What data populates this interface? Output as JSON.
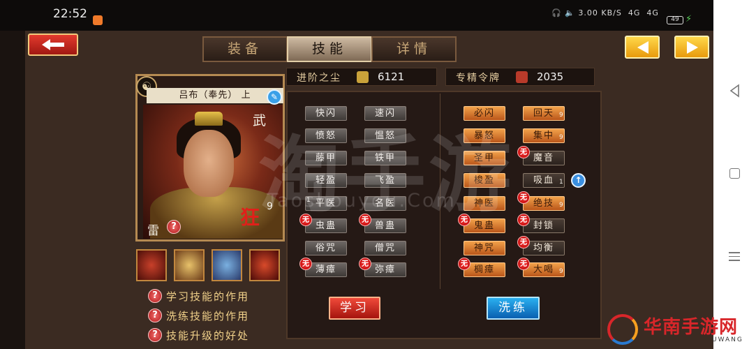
{
  "status_bar": {
    "time": "22:52",
    "network_speed": "3.00 KB/S",
    "signal_1": "4G",
    "signal_2": "4G",
    "battery": "49"
  },
  "tabs": [
    {
      "label": "装备",
      "active": false
    },
    {
      "label": "技能",
      "active": true
    },
    {
      "label": "详情",
      "active": false
    }
  ],
  "resources": {
    "dust_label": "进阶之尘",
    "dust_value": "6121",
    "token_label": "专精令牌",
    "token_value": "2035"
  },
  "hero": {
    "name": "吕布（奉先）",
    "rank": "上",
    "type": "武",
    "trait": "狂",
    "trait_level": "9",
    "element": "雷"
  },
  "skills_left": [
    {
      "name": "快闪",
      "style": "gray"
    },
    {
      "name": "速闪",
      "style": "gray"
    },
    {
      "name": "愤怒",
      "style": "gray"
    },
    {
      "name": "愠怒",
      "style": "gray"
    },
    {
      "name": "藤甲",
      "style": "gray"
    },
    {
      "name": "铁甲",
      "style": "gray"
    },
    {
      "name": "轻盈",
      "style": "gray"
    },
    {
      "name": "飞盈",
      "style": "gray"
    },
    {
      "name": "平医",
      "style": "gray",
      "level": "1"
    },
    {
      "name": "名医",
      "style": "gray"
    },
    {
      "name": "虫蛊",
      "style": "gray",
      "locked": true
    },
    {
      "name": "兽蛊",
      "style": "gray",
      "locked": true
    },
    {
      "name": "俗咒",
      "style": "gray"
    },
    {
      "name": "僧咒",
      "style": "gray"
    },
    {
      "name": "薄瘴",
      "style": "gray",
      "locked": true
    },
    {
      "name": "弥瘴",
      "style": "gray",
      "locked": true
    }
  ],
  "skills_right": [
    {
      "name": "必闪",
      "style": "orange"
    },
    {
      "name": "回天",
      "style": "orange",
      "level": "9"
    },
    {
      "name": "暴怒",
      "style": "orange"
    },
    {
      "name": "集中",
      "style": "orange",
      "level": "9"
    },
    {
      "name": "圣甲",
      "style": "orange"
    },
    {
      "name": "魔音",
      "style": "dark",
      "locked": true
    },
    {
      "name": "梭盈",
      "style": "orange"
    },
    {
      "name": "吸血",
      "style": "dark",
      "level": "1"
    },
    {
      "name": "神医",
      "style": "orange"
    },
    {
      "name": "绝技",
      "style": "orange",
      "level": "9",
      "locked": true
    },
    {
      "name": "鬼蛊",
      "style": "orange",
      "locked": true
    },
    {
      "name": "封锁",
      "style": "dark",
      "locked": true
    },
    {
      "name": "神咒",
      "style": "orange"
    },
    {
      "name": "均衡",
      "style": "dark",
      "locked": true
    },
    {
      "name": "椆瘴",
      "style": "orange",
      "locked": true
    },
    {
      "name": "大喝",
      "style": "orange",
      "level": "9",
      "locked": true
    }
  ],
  "lock_glyph": "无",
  "help_items": [
    {
      "label": "学习技能的作用"
    },
    {
      "label": "洗练技能的作用"
    },
    {
      "label": "技能升级的好处"
    }
  ],
  "buttons": {
    "learn": "学习",
    "refine": "洗练"
  },
  "watermarks": {
    "big": "淘手游",
    "url": "Taoshouyou.Com",
    "corner_name": "华南手游网",
    "corner_sub": "UWANG"
  },
  "icons": {
    "back": "arrow-left-icon",
    "prev": "triangle-left-icon",
    "next": "triangle-right-icon",
    "help": "question-icon",
    "edit": "pencil-icon",
    "upgrade": "arrow-up-icon"
  },
  "colors": {
    "accent_orange": "#e89a0c",
    "accent_red": "#d8262a",
    "accent_blue": "#2a8fe0"
  }
}
